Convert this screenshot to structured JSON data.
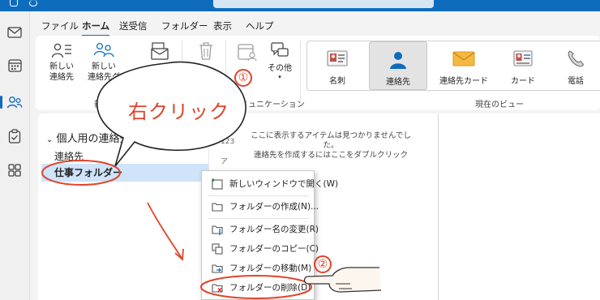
{
  "menu": {
    "tabs": [
      "ファイル",
      "ホーム",
      "送受信",
      "フォルダー",
      "表示",
      "ヘルプ"
    ],
    "active": "ホーム"
  },
  "ribbon": {
    "new_contact": "新しい\n連絡先",
    "new_contact_group": "新しい\n連絡先グ",
    "group_new_partial": "新",
    "other": "その他",
    "group_communication_partial": "ミュニケーション",
    "views": [
      "名刺",
      "連絡先",
      "連絡先カード",
      "カード",
      "電話"
    ],
    "selected_view": "連絡先",
    "group_current_view": "現在のビュー"
  },
  "folder_pane": {
    "group": "個人用の連絡先",
    "items": [
      "連絡先",
      "仕事フォルダー"
    ],
    "selected": "仕事フォルダー"
  },
  "list": {
    "empty_line1": "ここに表示するアイテムは見つかりませんでした。",
    "empty_line2": "連絡先を作成するにはここをダブルクリック",
    "alpha_index": [
      "123",
      "ア"
    ]
  },
  "context_menu": {
    "items": [
      "新しいウィンドウで開く(W)",
      "フォルダーの作成(N)...",
      "フォルダー名の変更(R)",
      "フォルダーのコピー(C)",
      "フォルダーの移動(M)",
      "フォルダーの削除(D)"
    ]
  },
  "annotations": {
    "bubble_text": "右クリック",
    "step1": "①",
    "step2": "②"
  },
  "colors": {
    "accent": "#0f6cbd",
    "annotation_red": "#e0452c",
    "selection": "#cfe4fa"
  }
}
